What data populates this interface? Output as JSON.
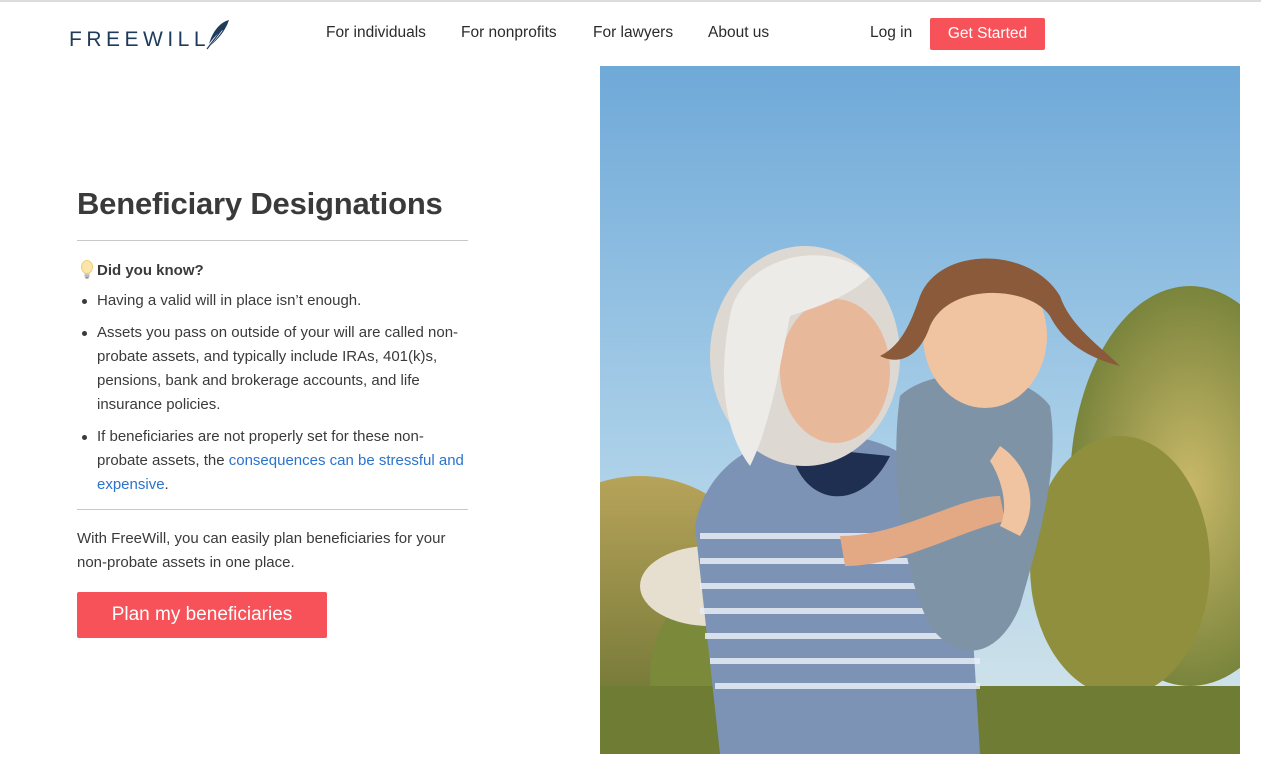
{
  "header": {
    "logo_text": "FREEWILL",
    "nav": [
      {
        "label": "For individuals"
      },
      {
        "label": "For nonprofits"
      },
      {
        "label": "For lawyers"
      },
      {
        "label": "About us"
      }
    ],
    "login_label": "Log in",
    "get_started_label": "Get Started",
    "accent_color": "#f7525a",
    "brand_color": "#1f3b5c"
  },
  "main": {
    "title": "Beneficiary Designations",
    "did_you_know": "Did you know?",
    "bullets": [
      {
        "text": "Having a valid will in place isn’t enough."
      },
      {
        "text": "Assets you pass on outside of your will are called non-probate assets, and typically include IRAs, 401(k)s, pensions, bank and brokerage accounts, and life insurance policies."
      },
      {
        "text_before": "If beneficiaries are not properly set for these non-probate assets, the ",
        "link": "consequences can be stressful and expensive",
        "text_after": "."
      }
    ],
    "closing": "With FreeWill, you can easily plan beneficiaries for your non-probate assets in one place.",
    "cta_label": "Plan my beneficiaries",
    "link_color": "#2a73cc"
  },
  "hero": {
    "icon": "photo-grandmother-granddaughter"
  }
}
